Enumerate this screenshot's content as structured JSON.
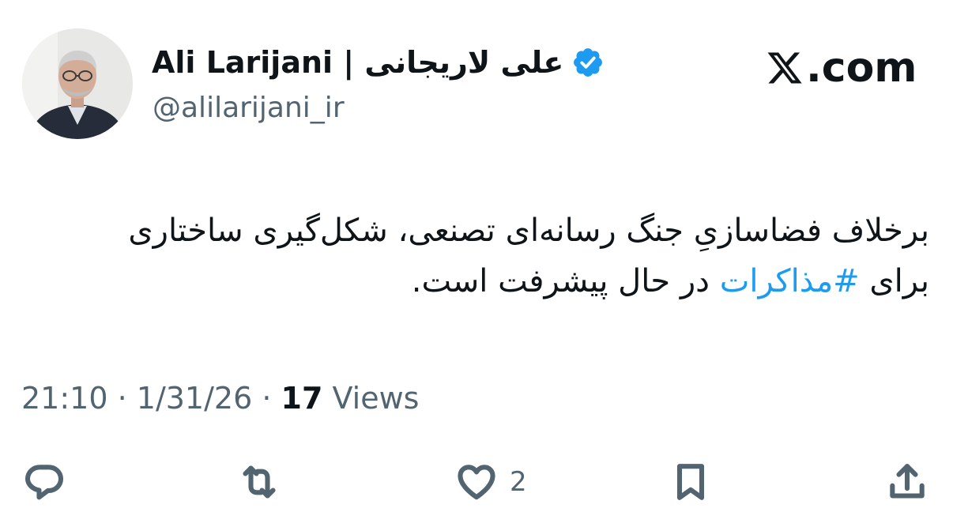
{
  "author": {
    "display_name": "Ali Larijani | علی لاریجانی",
    "handle": "@alilarijani_ir",
    "verified": true
  },
  "brand": {
    "label": ".com",
    "icon": "x-logo-icon"
  },
  "tweet": {
    "text_before": "برخلاف فضاسازیِ جنگ رسانه‌ای تصنعی، شکل‌گیری ساختاری برای ",
    "hashtag": "#مذاکرات",
    "text_after": " در حال پیشرفت است."
  },
  "meta": {
    "time": "21:10",
    "separator": " · ",
    "date": "1/31/26",
    "views_count": "17",
    "views_label": " Views"
  },
  "actions": {
    "reply": {
      "icon": "reply-icon",
      "count": ""
    },
    "repost": {
      "icon": "repost-icon",
      "count": ""
    },
    "like": {
      "icon": "heart-icon",
      "count": "2"
    },
    "bookmark": {
      "icon": "bookmark-icon",
      "count": ""
    },
    "share": {
      "icon": "share-icon",
      "count": ""
    }
  },
  "colors": {
    "text": "#0f1419",
    "secondary": "#536471",
    "hashtag": "#1d9bf0",
    "verified": "#1d9bf0"
  }
}
